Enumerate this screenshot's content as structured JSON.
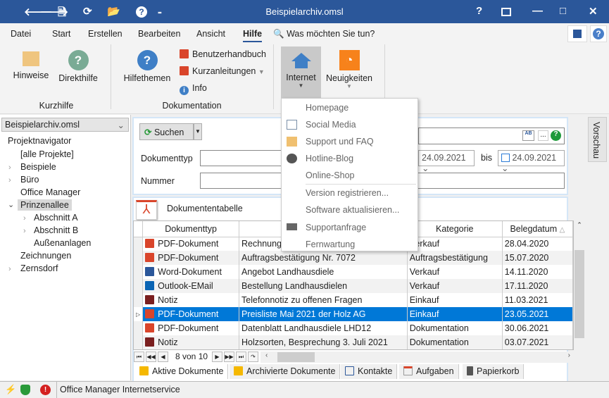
{
  "window": {
    "title": "Beispielarchiv.omsl",
    "help": "?",
    "min": "—",
    "max": "□",
    "close": "✕"
  },
  "qat": {
    "back": "🡐",
    "forward": "🡒",
    "new": "🗎",
    "refresh": "⟳",
    "open": "📂",
    "help": "?",
    "customize": "₌"
  },
  "ribbon": {
    "tabs": [
      "Datei",
      "Start",
      "Erstellen",
      "Bearbeiten",
      "Ansicht",
      "Hilfe"
    ],
    "active_tab": "Hilfe",
    "tell_me": "Was möchten Sie tun?",
    "groups": {
      "kurzhilfe": {
        "label": "Kurzhilfe",
        "buttons": [
          "Hinweise",
          "Direkthilfe"
        ]
      },
      "dokumentation": {
        "label": "Dokumentation",
        "large": "Hilfethemen",
        "small": [
          "Benutzerhandbuch",
          "Kurzanleitungen",
          "Info"
        ]
      },
      "internet": {
        "buttons": [
          "Internet",
          "Neuigkeiten"
        ]
      }
    }
  },
  "internet_menu": {
    "items": [
      "Homepage",
      "Social Media",
      "Support und FAQ",
      "Hotline-Blog",
      "Online-Shop",
      "Version registrieren...",
      "Software aktualisieren...",
      "Supportanfrage",
      "Fernwartung"
    ]
  },
  "sidebar": {
    "archive": "Beispielarchiv.omsl",
    "title": "Projektnavigator",
    "tree": [
      "[alle Projekte]",
      "Beispiele",
      "Büro",
      "Office Manager",
      "Prinzenallee",
      "Abschnitt A",
      "Abschnitt B",
      "Außenanlagen",
      "Zeichnungen",
      "Zernsdorf"
    ],
    "selected": "Prinzenallee"
  },
  "search": {
    "button": "Suchen",
    "doctype_label": "Dokumenttyp",
    "number_label": "Nummer",
    "date_from": "24.09.2021",
    "bis": "bis",
    "date_to": "24.09.2021",
    "ellipsis": "..."
  },
  "preview_tab": "Vorschau",
  "table": {
    "title": "Dokumententabelle",
    "columns": [
      "Dokumenttyp",
      "",
      "Kategorie",
      "Belegdatum"
    ],
    "rows": [
      {
        "type": "PDF-Dokument",
        "desc": "Rechnung",
        "cat": "Verkauf",
        "date": "28.04.2020",
        "icon": "pdf"
      },
      {
        "type": "PDF-Dokument",
        "desc": "Auftragsbestätigung Nr. 7072",
        "cat": "Auftragsbestätigung",
        "date": "15.07.2020",
        "icon": "pdf"
      },
      {
        "type": "Word-Dokument",
        "desc": "Angebot Landhausdiele",
        "cat": "Verkauf",
        "date": "14.11.2020",
        "icon": "word"
      },
      {
        "type": "Outlook-EMail",
        "desc": "Bestellung Landhausdielen",
        "cat": "Verkauf",
        "date": "17.11.2020",
        "icon": "outlook"
      },
      {
        "type": "Notiz",
        "desc": "Telefonnotiz zu offenen Fragen",
        "cat": "Einkauf",
        "date": "11.03.2021",
        "icon": "note"
      },
      {
        "type": "PDF-Dokument",
        "desc": "Preisliste Mai 2021 der Holz AG",
        "cat": "Einkauf",
        "date": "23.05.2021",
        "icon": "pdf"
      },
      {
        "type": "PDF-Dokument",
        "desc": "Datenblatt Landhausdiele LHD12",
        "cat": "Dokumentation",
        "date": "30.06.2021",
        "icon": "pdf"
      },
      {
        "type": "Notiz",
        "desc": "Holzsorten, Besprechung 3. Juli 2021",
        "cat": "Dokumentation",
        "date": "03.07.2021",
        "icon": "note"
      }
    ],
    "selected_row": 5,
    "pager": "8 von 10"
  },
  "bottom_tabs": [
    "Aktive Dokumente",
    "Archivierte Dokumente",
    "Kontakte",
    "Aufgaben",
    "Papierkorb"
  ],
  "status": {
    "text": "Office Manager Internetservice"
  },
  "colors": {
    "titlebar": "#2b579a",
    "selection": "#0078d7",
    "pdf": "#d9452b",
    "rss": "#f7821b",
    "home": "#3f7fc6"
  }
}
